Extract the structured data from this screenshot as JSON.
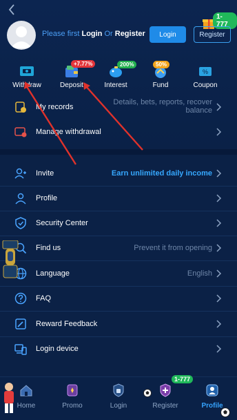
{
  "header": {
    "prompt_prefix": "Please first ",
    "prompt_login": "Login",
    "prompt_or": " Or ",
    "prompt_register": "Register",
    "login_button": "Login",
    "register_button": "Register",
    "promo_badge": "1-777"
  },
  "quick_actions": [
    {
      "label": "Withdraw",
      "icon": "withdraw-icon"
    },
    {
      "label": "Deposit",
      "icon": "deposit-icon",
      "badge": "+7.77%"
    },
    {
      "label": "Interest",
      "icon": "interest-icon",
      "badge": "200%"
    },
    {
      "label": "Fund",
      "icon": "fund-icon",
      "badge": "50%"
    },
    {
      "label": "Coupon",
      "icon": "coupon-icon"
    }
  ],
  "menu_top": [
    {
      "label": "My records",
      "value_line1": "Details, bets, reports, recover",
      "value_line2": "balance",
      "icon": "records-icon"
    },
    {
      "label": "Manage withdrawal",
      "value": "",
      "icon": "card-settings-icon"
    }
  ],
  "menu_main": [
    {
      "label": "Invite",
      "value": "Earn unlimited daily income",
      "icon": "invite-icon"
    },
    {
      "label": "Profile",
      "value": "",
      "icon": "profile-icon"
    },
    {
      "label": "Security Center",
      "value": "",
      "icon": "shield-icon"
    },
    {
      "label": "Find us",
      "value": "Prevent it from opening",
      "icon": "find-icon"
    },
    {
      "label": "Language",
      "value": "English",
      "icon": "globe-icon"
    },
    {
      "label": "FAQ",
      "value": "",
      "icon": "question-icon"
    },
    {
      "label": "Reward Feedback",
      "value": "",
      "icon": "feedback-icon"
    },
    {
      "label": "Login device",
      "value": "",
      "icon": "device-icon"
    }
  ],
  "tabbar": {
    "items": [
      {
        "label": "Home",
        "active": false
      },
      {
        "label": "Promo",
        "active": false
      },
      {
        "label": "Login",
        "active": false
      },
      {
        "label": "Register",
        "active": false,
        "badge": "1-777"
      },
      {
        "label": "Profile",
        "active": true
      }
    ]
  },
  "colors": {
    "background": "#0b2146",
    "accent": "#1f8be8",
    "link": "#4b9ef5",
    "muted": "#6e86a8",
    "active_tab": "#35a4ff",
    "arrow": "#e0322b"
  }
}
